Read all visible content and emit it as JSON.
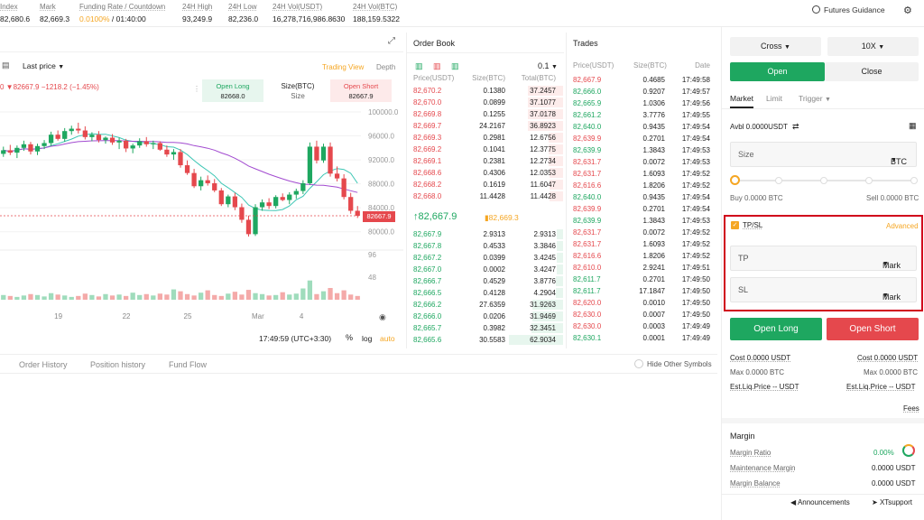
{
  "header": {
    "stats": [
      {
        "label": "Index",
        "value": "82,680.6"
      },
      {
        "label": "Mark",
        "value": "82,669.3"
      },
      {
        "label": "Funding Rate / Countdown",
        "value_rate": "0.0100%",
        "value_time": " / 01:40:00"
      },
      {
        "label": "24H High",
        "value": "93,249.9"
      },
      {
        "label": "24H Low",
        "value": "82,236.0"
      },
      {
        "label": "24H Vol(USDT)",
        "value": "16,278,716,986.8630"
      },
      {
        "label": "24H Vol(BTC)",
        "value": "188,159.5322"
      }
    ],
    "futures_guidance": "Futures Guidance"
  },
  "chart": {
    "price_type": "Last price",
    "views": [
      "Trading View",
      "Depth"
    ],
    "legend": "0  ▼82667.9  −1218.2 (−1.45%)",
    "open_long": "Open Long",
    "open_long_price": "82668.0",
    "size_label": "Size(BTC)",
    "size_value": "Size",
    "open_short": "Open Short",
    "open_short_price": "82667.9",
    "last_tag": "82667.9",
    "time": "17:49:59 (UTC+3:30)",
    "opts": [
      "%",
      "log",
      "auto"
    ],
    "x_labels": [
      "19",
      "22",
      "25",
      "Mar",
      "4"
    ]
  },
  "chart_data": {
    "type": "candlestick",
    "y_ticks": [
      100000,
      96000,
      92000,
      88000,
      84000,
      80000
    ],
    "ylim": [
      78000,
      101500
    ],
    "vol_ticks": [
      96,
      48
    ],
    "last": 82667.9,
    "candles": [
      [
        93000,
        94200,
        92500,
        93600
      ],
      [
        93600,
        94500,
        92800,
        93200
      ],
      [
        93200,
        94400,
        92300,
        94000
      ],
      [
        94000,
        95200,
        93500,
        94600
      ],
      [
        94600,
        95000,
        92900,
        93400
      ],
      [
        93400,
        94700,
        92800,
        94300
      ],
      [
        94300,
        95300,
        93800,
        94800
      ],
      [
        94800,
        96700,
        94300,
        96200
      ],
      [
        96200,
        96900,
        95200,
        95500
      ],
      [
        95500,
        97300,
        95000,
        96800
      ],
      [
        96800,
        97700,
        96200,
        97200
      ],
      [
        97200,
        98200,
        96400,
        96900
      ],
      [
        96900,
        97600,
        95400,
        95800
      ],
      [
        95800,
        96600,
        95100,
        96200
      ],
      [
        96200,
        96800,
        94900,
        95300
      ],
      [
        95300,
        95900,
        94700,
        95700
      ],
      [
        95700,
        96300,
        94500,
        94900
      ],
      [
        94900,
        95700,
        93800,
        95200
      ],
      [
        95200,
        95500,
        93300,
        93900
      ],
      [
        93900,
        94700,
        93100,
        94400
      ],
      [
        94400,
        95600,
        94000,
        95100
      ],
      [
        95100,
        95800,
        94200,
        94600
      ],
      [
        94600,
        95200,
        93800,
        94800
      ],
      [
        94800,
        95100,
        93500,
        93700
      ],
      [
        93700,
        94400,
        92500,
        92900
      ],
      [
        92900,
        93800,
        92000,
        93300
      ],
      [
        93300,
        93800,
        90700,
        91100
      ],
      [
        91100,
        91900,
        89500,
        89800
      ],
      [
        89800,
        90500,
        87300,
        87600
      ],
      [
        87600,
        89200,
        86900,
        88600
      ],
      [
        88600,
        89400,
        87700,
        88100
      ],
      [
        88100,
        88800,
        86600,
        86900
      ],
      [
        86900,
        87300,
        84300,
        84600
      ],
      [
        84600,
        86200,
        84100,
        85900
      ],
      [
        85900,
        86500,
        83600,
        84100
      ],
      [
        84100,
        84700,
        81500,
        82000
      ],
      [
        82000,
        82700,
        79200,
        79600
      ],
      [
        79600,
        84600,
        79300,
        84100
      ],
      [
        84100,
        85400,
        83500,
        84900
      ],
      [
        84900,
        85600,
        83800,
        84300
      ],
      [
        84300,
        86100,
        83900,
        85800
      ],
      [
        85800,
        86400,
        85100,
        85300
      ],
      [
        85300,
        86600,
        84600,
        86200
      ],
      [
        86200,
        87200,
        85500,
        86800
      ],
      [
        86800,
        88600,
        86300,
        88100
      ],
      [
        88100,
        94900,
        87800,
        94200
      ],
      [
        94200,
        95200,
        91400,
        91900
      ],
      [
        91900,
        94700,
        91500,
        94200
      ],
      [
        94200,
        94900,
        89200,
        89700
      ],
      [
        89700,
        90900,
        88400,
        88900
      ],
      [
        88900,
        89600,
        85400,
        85800
      ],
      [
        85800,
        86500,
        83000,
        83500
      ],
      [
        83500,
        84300,
        82300,
        82669
      ]
    ],
    "volumes": [
      10,
      8,
      6,
      9,
      12,
      10,
      7,
      14,
      11,
      9,
      6,
      8,
      13,
      10,
      7,
      12,
      9,
      11,
      8,
      15,
      10,
      12,
      9,
      13,
      11,
      22,
      18,
      12,
      9,
      15,
      20,
      10,
      8,
      13,
      17,
      11,
      21,
      14,
      12,
      9,
      10,
      16,
      11,
      13,
      24,
      41,
      12,
      18,
      25,
      14,
      20,
      11,
      8
    ]
  },
  "orderbook": {
    "title": "Order Book",
    "depth": "0.1",
    "headers": [
      "Price(USDT)",
      "Size(BTC)",
      "Total(BTC)"
    ],
    "asks": [
      [
        "82,670.2",
        "0.1380",
        "37.2457"
      ],
      [
        "82,670.0",
        "0.0899",
        "37.1077"
      ],
      [
        "82,669.8",
        "0.1255",
        "37.0178"
      ],
      [
        "82,669.7",
        "24.2167",
        "36.8923"
      ],
      [
        "82,669.3",
        "0.2981",
        "12.6756"
      ],
      [
        "82,669.2",
        "0.1041",
        "12.3775"
      ],
      [
        "82,669.1",
        "0.2381",
        "12.2734"
      ],
      [
        "82,668.6",
        "0.4306",
        "12.0353"
      ],
      [
        "82,668.2",
        "0.1619",
        "11.6047"
      ],
      [
        "82,668.0",
        "11.4428",
        "11.4428"
      ]
    ],
    "mid_last": "↑82,667.9",
    "mid_mark": "82,669.3",
    "bids": [
      [
        "82,667.9",
        "2.9313",
        "2.9313"
      ],
      [
        "82,667.8",
        "0.4533",
        "3.3846"
      ],
      [
        "82,667.2",
        "0.0399",
        "3.4245"
      ],
      [
        "82,667.0",
        "0.0002",
        "3.4247"
      ],
      [
        "82,666.7",
        "0.4529",
        "3.8776"
      ],
      [
        "82,666.5",
        "0.4128",
        "4.2904"
      ],
      [
        "82,666.2",
        "27.6359",
        "31.9263"
      ],
      [
        "82,666.0",
        "0.0206",
        "31.9469"
      ],
      [
        "82,665.7",
        "0.3982",
        "32.3451"
      ],
      [
        "82,665.6",
        "30.5583",
        "62.9034"
      ]
    ]
  },
  "trades": {
    "title": "Trades",
    "headers": [
      "Price(USDT)",
      "Size(BTC)",
      "Date"
    ],
    "rows": [
      [
        "82,667.9",
        "0.4685",
        "17:49:58",
        "r"
      ],
      [
        "82,666.0",
        "0.9207",
        "17:49:57",
        "g"
      ],
      [
        "82,665.9",
        "1.0306",
        "17:49:56",
        "g"
      ],
      [
        "82,661.2",
        "3.7776",
        "17:49:55",
        "g"
      ],
      [
        "82,640.0",
        "0.9435",
        "17:49:54",
        "g"
      ],
      [
        "82,639.9",
        "0.2701",
        "17:49:54",
        "r"
      ],
      [
        "82,639.9",
        "1.3843",
        "17:49:53",
        "g"
      ],
      [
        "82,631.7",
        "0.0072",
        "17:49:53",
        "r"
      ],
      [
        "82,631.7",
        "1.6093",
        "17:49:52",
        "r"
      ],
      [
        "82,616.6",
        "1.8206",
        "17:49:52",
        "r"
      ],
      [
        "82,640.0",
        "0.9435",
        "17:49:54",
        "g"
      ],
      [
        "82,639.9",
        "0.2701",
        "17:49:54",
        "r"
      ],
      [
        "82,639.9",
        "1.3843",
        "17:49:53",
        "g"
      ],
      [
        "82,631.7",
        "0.0072",
        "17:49:52",
        "r"
      ],
      [
        "82,631.7",
        "1.6093",
        "17:49:52",
        "r"
      ],
      [
        "82,616.6",
        "1.8206",
        "17:49:52",
        "r"
      ],
      [
        "82,610.0",
        "2.9241",
        "17:49:51",
        "r"
      ],
      [
        "82,611.7",
        "0.2701",
        "17:49:50",
        "g"
      ],
      [
        "82,611.7",
        "17.1847",
        "17:49:50",
        "g"
      ],
      [
        "82,620.0",
        "0.0010",
        "17:49:50",
        "r"
      ],
      [
        "82,630.0",
        "0.0007",
        "17:49:50",
        "r"
      ],
      [
        "82,630.0",
        "0.0003",
        "17:49:49",
        "r"
      ],
      [
        "82,630.1",
        "0.0001",
        "17:49:49",
        "g"
      ]
    ]
  },
  "tabs": [
    "Order History",
    "Position history",
    "Fund Flow"
  ],
  "hide_other": "Hide Other Symbols",
  "panel": {
    "margin_mode": "Cross",
    "leverage": "10X",
    "open": "Open",
    "close": "Close",
    "order_types": [
      "Market",
      "Limit",
      "Trigger"
    ],
    "avbl": "Avbl 0.0000USDT",
    "size": "Size",
    "size_unit": "BTC",
    "buy": "Buy 0.0000 BTC",
    "sell": "Sell 0.0000 BTC",
    "slider_pct": 0,
    "tpsl": "TP/SL",
    "advanced": "Advanced",
    "tp": "TP",
    "sl": "SL",
    "mark": "Mark",
    "open_long": "Open Long",
    "open_short": "Open Short",
    "cost_l": "Cost 0.0000 USDT",
    "cost_r": "Cost 0.0000 USDT",
    "max_l": "Max 0.0000 BTC",
    "max_r": "Max 0.0000 BTC",
    "liq_l": "Est.Liq.Price -- USDT",
    "liq_r": "Est.Liq.Price -- USDT",
    "fees": "Fees",
    "margin": "Margin",
    "margin_ratio": "Margin Ratio",
    "margin_ratio_val": "0.00%",
    "maint": "Maintenance Margin",
    "maint_val": "0.0000 USDT",
    "balance": "Margin Balance",
    "balance_val": "0.0000 USDT",
    "announcements": "Announcements",
    "support": "XTsupport"
  },
  "colors": {
    "green": "#1ea760",
    "red": "#e5484d",
    "highlight": "#d0021b",
    "accent": "#f5a623"
  }
}
